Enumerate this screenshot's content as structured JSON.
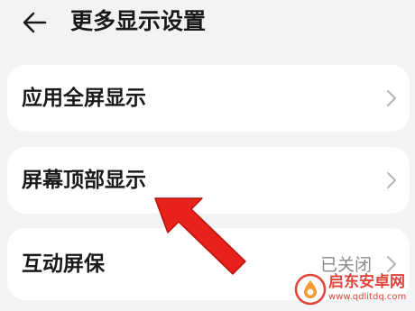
{
  "header": {
    "title": "更多显示设置",
    "back_icon": "back-arrow-icon"
  },
  "settings": {
    "items": [
      {
        "label": "应用全屏显示",
        "icon": "chevron-right-icon"
      },
      {
        "label": "屏幕顶部显示",
        "icon": "chevron-right-icon"
      },
      {
        "label": "互动屏保",
        "value": "已关闭",
        "icon": "chevron-right-icon"
      }
    ]
  },
  "annotation": {
    "icon": "red-pointer-arrow-icon",
    "color": "#e8211b"
  },
  "watermark": {
    "name": "启东安卓网",
    "url": "www.qdlitdq.com",
    "color": "#e0443b"
  },
  "colors": {
    "background": "#f1f3f5",
    "card": "#ffffff",
    "text": "#1a1a1a",
    "secondary_text": "#8a8a8a"
  }
}
